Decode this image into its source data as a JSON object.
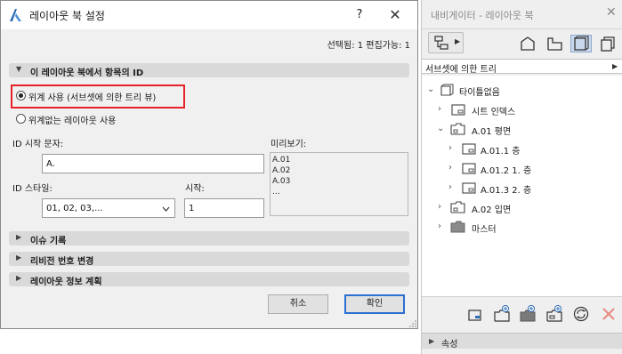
{
  "dialog": {
    "title": "레이아웃 북 설정",
    "help_label": "?",
    "close_label": "✕",
    "status": "선택됨: 1 편집가능: 1",
    "section_id": {
      "label": "이 레이아웃 북에서 항목의 ID"
    },
    "radio_use_id": {
      "label": "위계 사용 (서브셋에 의한 트리 뷰)",
      "checked": true
    },
    "radio_no_id": {
      "label": "위계없는 레이아웃 사용",
      "checked": false
    },
    "id_prefix": {
      "label": "ID 시작 문자:",
      "value": "A."
    },
    "id_style": {
      "label": "ID 스타일:",
      "value": "01, 02, 03,..."
    },
    "start": {
      "label": "시작:",
      "value": "1"
    },
    "preview": {
      "label": "미리보기:",
      "lines": [
        "A.01",
        "A.02",
        "A.03",
        "..."
      ]
    },
    "sections": [
      {
        "label": "이슈 기록"
      },
      {
        "label": "리비전 번호 변경"
      },
      {
        "label": "레이아웃 정보 계획"
      }
    ],
    "cancel_label": "취소",
    "ok_label": "확인",
    "accent_color": "#e8202a"
  },
  "navigator": {
    "title": "내비게이터 - 레이아웃 북",
    "close_label": "✕",
    "view_dropdown": "서브셋에 의한 트리",
    "tree": [
      {
        "label": "타이틀없음",
        "icon": "layout-book-icon",
        "chevron": "down"
      },
      {
        "label": "시트 인덱스",
        "icon": "sheet-index-icon",
        "chevron": "right"
      },
      {
        "label": "A.01 평면",
        "icon": "subset-folder-icon",
        "chevron": "down"
      },
      {
        "label": "A.01.1 층",
        "icon": "layout-icon",
        "chevron": "right"
      },
      {
        "label": "A.01.2 1. 층",
        "icon": "layout-icon",
        "chevron": "right"
      },
      {
        "label": "A.01.3 2. 층",
        "icon": "layout-icon",
        "chevron": "right"
      },
      {
        "label": "A.02 입면",
        "icon": "subset-folder-icon",
        "chevron": "right"
      },
      {
        "label": "마스터",
        "icon": "master-folder-icon",
        "chevron": "right"
      }
    ],
    "properties_label": "속성"
  }
}
